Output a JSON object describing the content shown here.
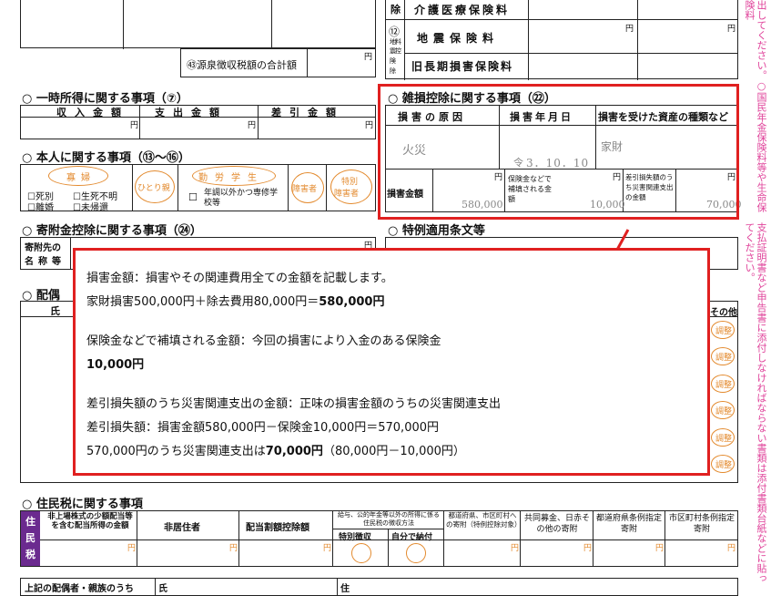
{
  "insurance": {
    "deduction_char": "除",
    "num12": "⑫",
    "side_chars": [
      "地",
      "料",
      "震",
      "控",
      "険",
      "除"
    ],
    "nursing_label": "介護医療保険料",
    "earthquake_label": "地震保険料",
    "old_longterm_label": "旧長期損害保険料",
    "yen": "円",
    "withholding_total_label": "㊸源泉徴収税額の合計額"
  },
  "temporary_income": {
    "title": "○ 一時所得に関する事項（⑦）",
    "headers": [
      "収入金額",
      "支出金額",
      "差引金額"
    ],
    "yen": "円"
  },
  "person": {
    "title": "○ 本人に関する事項（⑬〜⑯）",
    "widow": "寡婦",
    "single_parent": "ひとり親",
    "working_student": "勤労学生",
    "disabled": "障害者",
    "special_disabled": "特別障害者",
    "checks": [
      "死別",
      "生死不明",
      "離婚",
      "未帰還"
    ],
    "student_note": "年調以外かつ専修学校等"
  },
  "donation": {
    "title": "○ 寄附金控除に関する事項（㉔）",
    "name_label_1": "寄附先の",
    "name_label_2": "名称等",
    "yen": "円"
  },
  "spouse": {
    "title_fragment": "○ 配偶",
    "col_name": "氏",
    "col_other": "その他",
    "marks": [
      "調整",
      "調整",
      "調整",
      "調整",
      "調整",
      "調整"
    ]
  },
  "casualty": {
    "title": "○ 雑損控除に関する事項（㉒）",
    "col_cause": "損害の原因",
    "col_date": "損害年月日",
    "col_asset": "損害を受けた資産の種類など",
    "cause": "火災",
    "date_prefix": "令",
    "date": "3．10．10",
    "asset": "家財",
    "loss_label": "損害金額",
    "loss_value": "580,000",
    "insurance_label": "保険金などで補填される金額",
    "insurance_value": "10,000",
    "disaster_label": "差引損失額のうち災害関連支出の金額",
    "disaster_value": "70,000",
    "yen": "円"
  },
  "special_provisions": {
    "title": "○ 特例適用条文等"
  },
  "resident_tax": {
    "title": "○ 住民税に関する事項",
    "side": [
      "住",
      "民",
      "税"
    ],
    "headers": [
      "非上場株式の少額配当等を含む配当所得の金額",
      "非居住者",
      "配当割額控除額",
      "給与、公的年金等以外の所得に係る住民税の徴収方法",
      "都道府県、市区町村への寄附（特例控除対象）",
      "共同募金、日赤その他の寄附",
      "都道府県条例指定寄附",
      "市区町村条例指定寄附"
    ],
    "special_collection": "特別徴収",
    "self_pay": "自分で納付",
    "yen": "円"
  },
  "footer": {
    "relatives_label": "上記の配偶者・親族のうち",
    "name_char": "氏",
    "address_char": "住"
  },
  "right_margin_text": "出してください。○国民年金保険料等や生命保険料",
  "right_margin_text_2": "支払証明書など申告書に添付しなければならない書類は添付書類台紙などに貼ってください。",
  "callout": {
    "l1": "損害金額：損害やその関連費用全ての金額を記載します。",
    "l2_pre": "家財損害500,000円＋除去費用80,000円＝",
    "l2_bold": "580,000円",
    "l3": "保険金などで補填される金額：今回の損害により入金のある保険金",
    "l4_bold": "10,000円",
    "l5": "差引損失額のうち災害関連支出の金額：正味の損害金額のうちの災害関連支出",
    "l6": "差引損失額：損害金額580,000円－保険金10,000円＝570,000円",
    "l7_pre": "570,000円のうち災害関連支出は",
    "l7_bold": "70,000円",
    "l7_post": "（80,000円－10,000円）"
  },
  "colors": {
    "highlight": "#e02020",
    "pink": "#e0449b",
    "orange": "#e38a2e",
    "purple": "#6b2a8f"
  }
}
